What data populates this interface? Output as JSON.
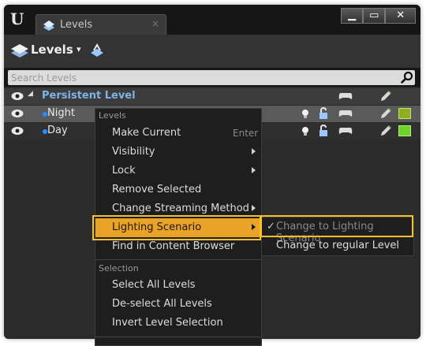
{
  "window": {
    "tab_label": "Levels",
    "tab_close": "×",
    "controls": {
      "minimize": "▁",
      "maximize": "▭",
      "close": "✕"
    }
  },
  "toolbar": {
    "levels_label": "Levels",
    "caret": "▾"
  },
  "search": {
    "placeholder": "Search Levels",
    "value": ""
  },
  "levels": [
    {
      "name": "Persistent Level",
      "expand_glyph": "◢"
    },
    {
      "name": "Night"
    },
    {
      "name": "Day"
    }
  ],
  "context_menu": {
    "section_levels": "Levels",
    "items": [
      {
        "label": "Make Current",
        "shortcut": "Enter"
      },
      {
        "label": "Visibility"
      },
      {
        "label": "Lock"
      },
      {
        "label": "Remove Selected"
      },
      {
        "label": "Change Streaming Method"
      },
      {
        "label": "Lighting Scenario"
      },
      {
        "label": "Find in Content Browser"
      }
    ],
    "section_selection": "Selection",
    "selection_items": [
      {
        "label": "Select All Levels"
      },
      {
        "label": "De-select All Levels"
      },
      {
        "label": "Invert Level Selection"
      }
    ]
  },
  "submenu": {
    "items": [
      {
        "check": "✓",
        "label": "Change to Lighting Scenario"
      },
      {
        "label": "Change to regular Level"
      }
    ]
  },
  "colors": {
    "accent": "#eaa227",
    "highlight_border": "#f7c12a",
    "level_dot": "#2a8cff",
    "persistent_text": "#7fb3e6",
    "level_color_swatch": "#8fbf2a"
  },
  "icons": [
    "unreal-logo-icon",
    "levels-icon",
    "world-icon",
    "search-icon",
    "eye-icon",
    "lightbulb-icon",
    "lock-icon",
    "gamepad-icon",
    "pencil-icon"
  ]
}
